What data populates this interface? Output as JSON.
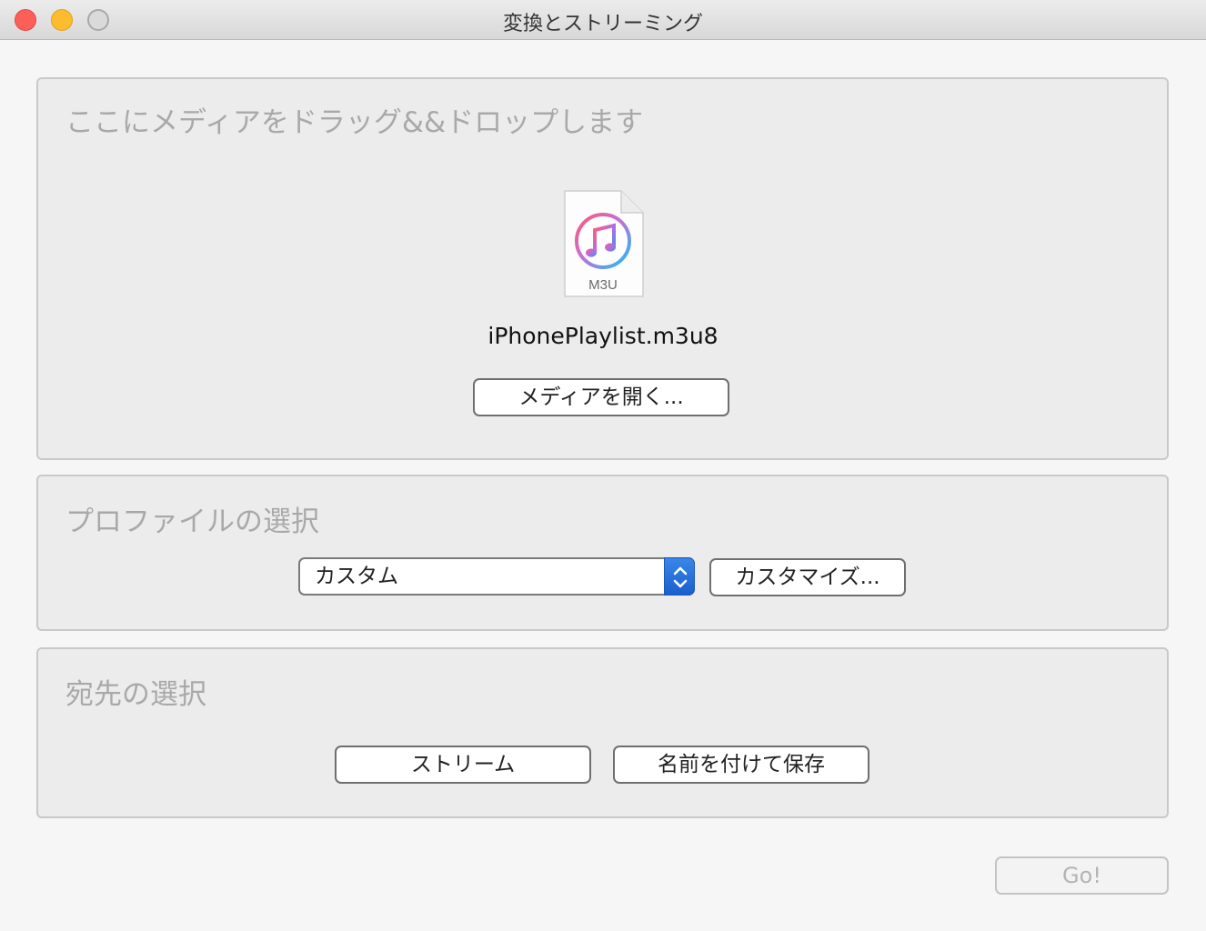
{
  "window": {
    "title": "変換とストリーミング"
  },
  "media_section": {
    "title": "ここにメディアをドラッグ&&ドロップします",
    "file_icon_label": "M3U",
    "file_name": "iPhonePlaylist.m3u8",
    "open_button_label": "メディアを開く..."
  },
  "profile_section": {
    "title": "プロファイルの選択",
    "selected_profile": "カスタム",
    "customize_button_label": "カスタマイズ..."
  },
  "destination_section": {
    "title": "宛先の選択",
    "stream_button_label": "ストリーム",
    "save_as_button_label": "名前を付けて保存"
  },
  "footer": {
    "go_button_label": "Go!"
  },
  "colors": {
    "close": "#fc5f57",
    "minimize": "#fdbc2e",
    "select_accent": "#1a5fcf"
  }
}
